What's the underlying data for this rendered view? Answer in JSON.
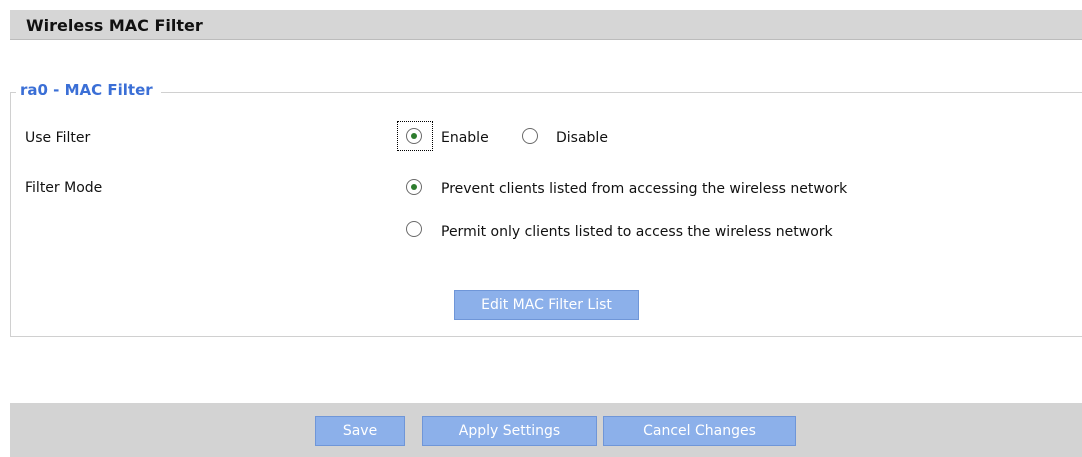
{
  "header": {
    "title": "Wireless MAC Filter"
  },
  "mac_filter": {
    "legend": "ra0 - MAC Filter",
    "use_filter": {
      "label": "Use Filter",
      "options": [
        {
          "label": "Enable",
          "checked": true
        },
        {
          "label": "Disable",
          "checked": false
        }
      ]
    },
    "filter_mode": {
      "label": "Filter Mode",
      "options": [
        {
          "label": "Prevent clients listed from accessing the wireless network",
          "checked": true
        },
        {
          "label": "Permit only clients listed to access the wireless network",
          "checked": false
        }
      ]
    },
    "edit_button": "Edit MAC Filter List"
  },
  "footer": {
    "save": "Save",
    "apply": "Apply Settings",
    "cancel": "Cancel Changes"
  },
  "colors": {
    "accent_blue": "#3b6fd6",
    "button_bg": "#8cb0ea",
    "header_bg": "#d6d6d6"
  }
}
